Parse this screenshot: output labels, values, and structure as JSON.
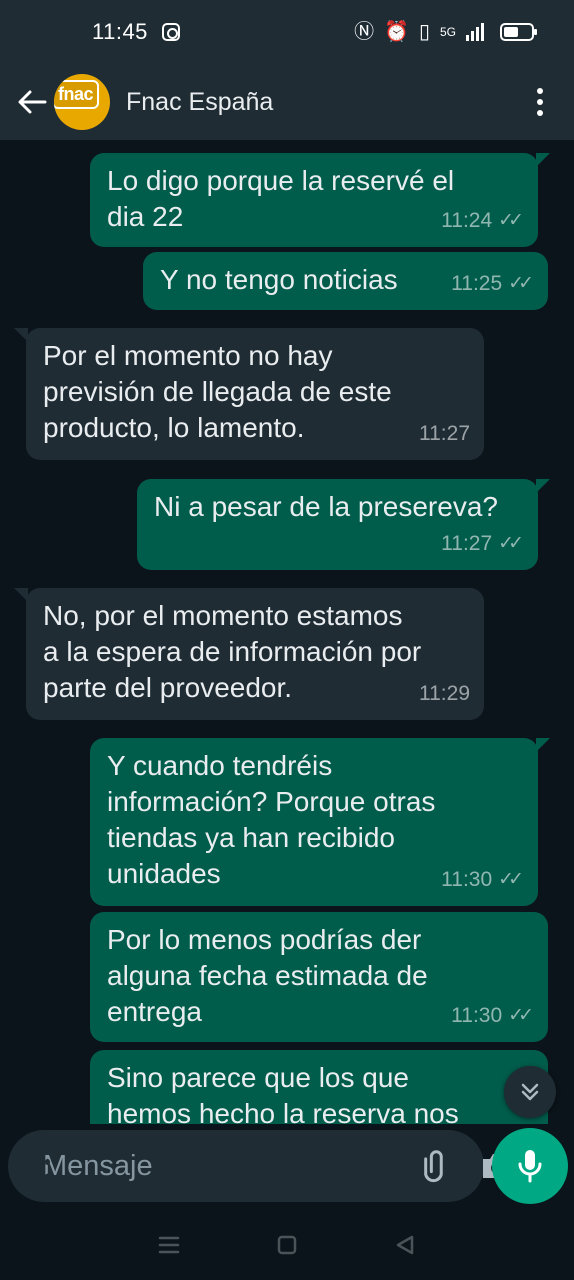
{
  "status_bar": {
    "time": "11:45",
    "network": "5G"
  },
  "header": {
    "contact_name": "Fnac España",
    "avatar_text": "fnac"
  },
  "messages": [
    {
      "direction": "out",
      "text": "Lo digo porque la reservé el\ndia 22",
      "time": "11:24",
      "status": "read"
    },
    {
      "direction": "out",
      "text": "Y no tengo noticias",
      "time": "11:25",
      "status": "read"
    },
    {
      "direction": "in",
      "text": "Por el momento no hay\nprevisión de llegada de este\nproducto, lo lamento.",
      "time": "11:27"
    },
    {
      "direction": "out",
      "text": "Ni a pesar de la presereva?",
      "time": "11:27",
      "status": "read"
    },
    {
      "direction": "in",
      "text": "No, por el momento estamos\na la espera de información por\nparte del proveedor.",
      "time": "11:29"
    },
    {
      "direction": "out",
      "text": "Y cuando tendréis\ninformación? Porque otras\ntiendas ya han recibido\nunidades",
      "time": "11:30",
      "status": "read"
    },
    {
      "direction": "out",
      "text": "Por lo menos podrías der\nalguna fecha estimada de\nentrega",
      "time": "11:30",
      "status": "read"
    },
    {
      "direction": "out",
      "text": "Sino parece que los que\nhemos hecho la reserva nos",
      "time": "",
      "status": ""
    }
  ],
  "input": {
    "placeholder": "Mensaje"
  },
  "colors": {
    "background": "#0b141a",
    "bar": "#1f2c34",
    "outgoing_bubble": "#005c4b",
    "incoming_bubble": "#1f2c34",
    "accent": "#00a884"
  }
}
